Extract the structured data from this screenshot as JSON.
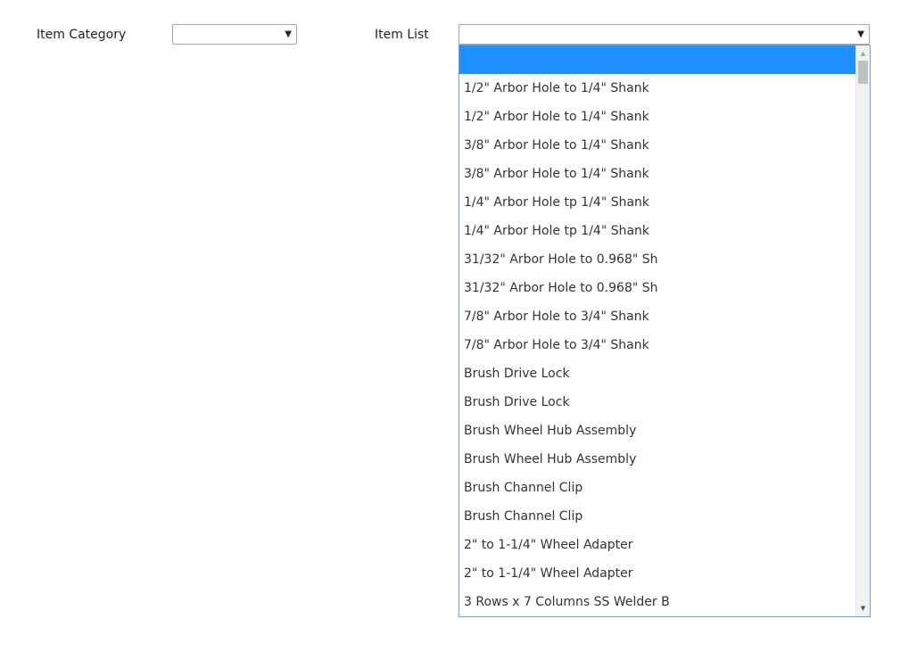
{
  "form": {
    "category_label": "Item Category",
    "category_value": "",
    "list_label": "Item List",
    "list_value": ""
  },
  "dropdown": {
    "options": [
      "",
      "1/2\" Arbor Hole to 1/4\" Shank",
      "1/2\" Arbor Hole to 1/4\" Shank",
      "3/8\" Arbor Hole to 1/4\" Shank",
      "3/8\" Arbor Hole to 1/4\" Shank",
      "1/4\" Arbor Hole tp 1/4\" Shank",
      "1/4\" Arbor Hole tp 1/4\" Shank",
      "31/32\" Arbor Hole to 0.968\" Sh",
      "31/32\" Arbor Hole to 0.968\" Sh",
      "7/8\" Arbor Hole to 3/4\" Shank",
      "7/8\" Arbor Hole to 3/4\" Shank",
      "Brush Drive Lock",
      "Brush Drive Lock",
      "Brush Wheel Hub Assembly",
      "Brush Wheel Hub Assembly",
      "Brush Channel Clip",
      "Brush Channel Clip",
      "2\" to 1-1/4\" Wheel Adapter",
      "2\" to 1-1/4\" Wheel Adapter",
      "3 Rows x 7 Columns SS Welder B"
    ],
    "selected_index": 0,
    "highlight_color": "#1e90ff"
  },
  "icons": {
    "caret": "▼",
    "scroll_up": "▲",
    "scroll_down": "▼"
  }
}
